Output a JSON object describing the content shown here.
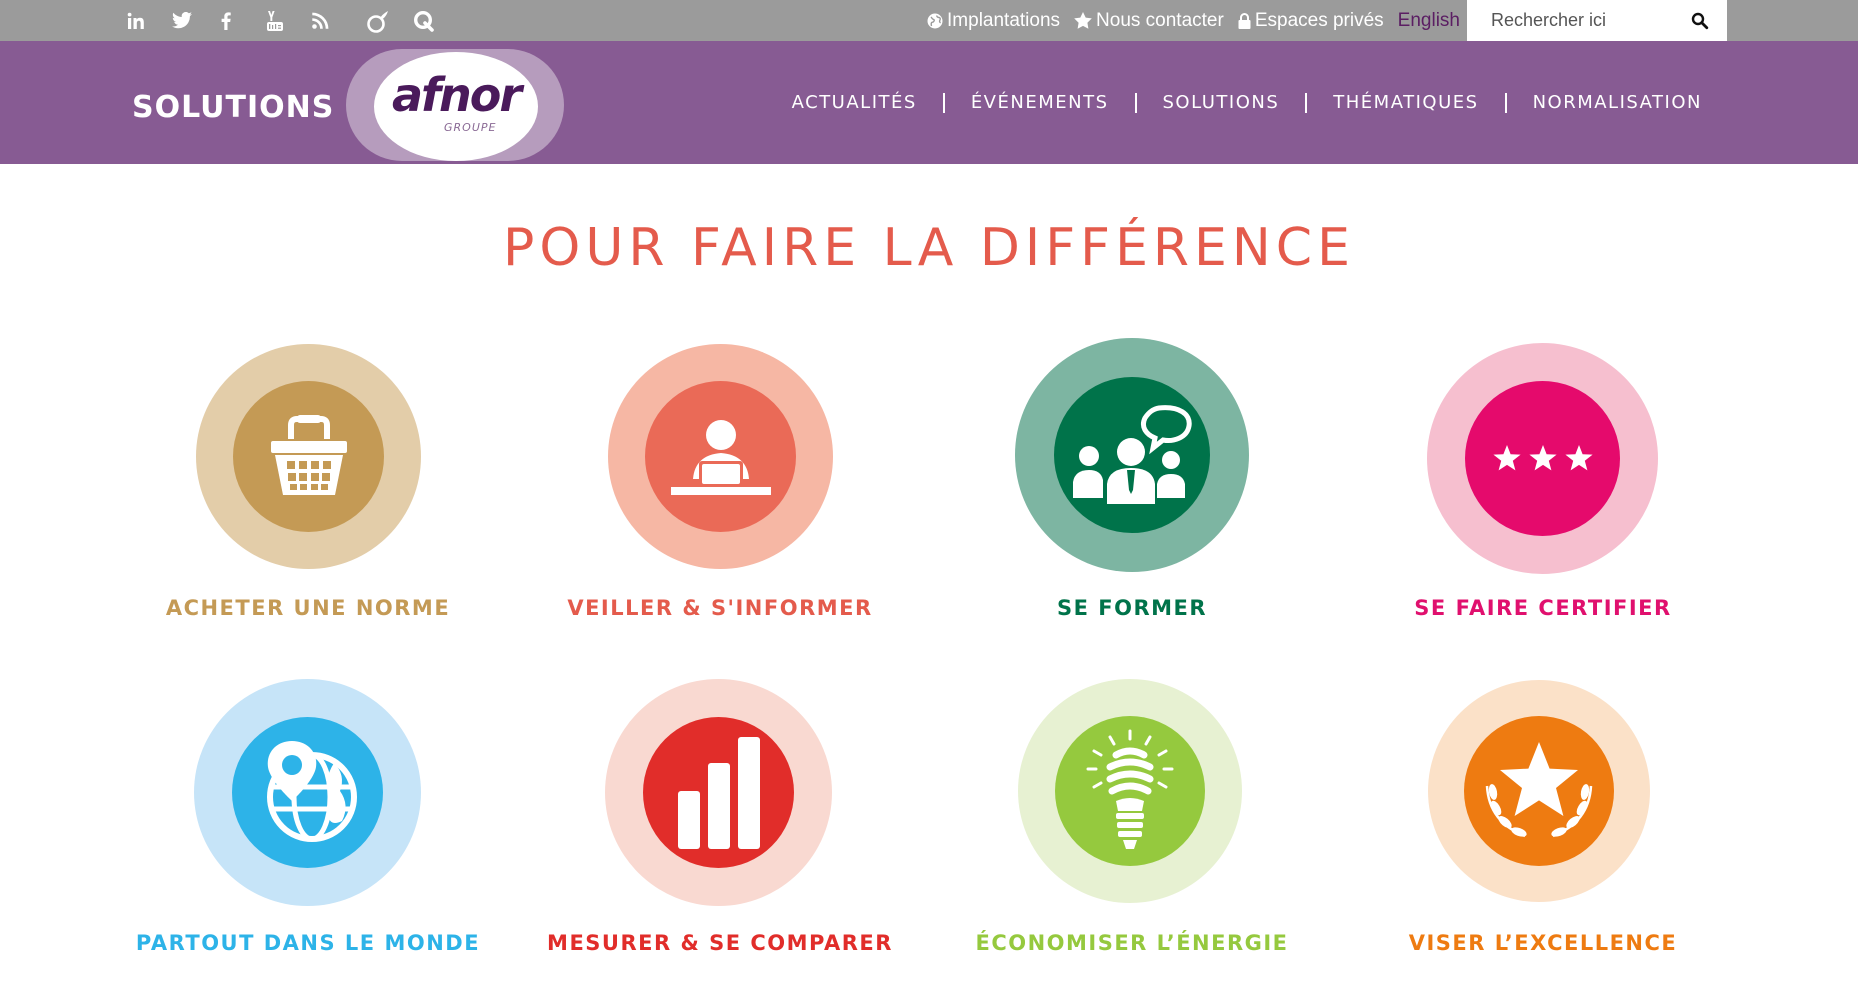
{
  "topbar": {
    "social": [
      {
        "name": "linkedin-icon"
      },
      {
        "name": "twitter-icon"
      },
      {
        "name": "facebook-icon"
      },
      {
        "name": "youtube-icon"
      },
      {
        "name": "rss-icon"
      },
      {
        "name": "viadeo-icon"
      },
      {
        "name": "q-icon"
      }
    ],
    "links": {
      "implantations": "Implantations",
      "contact": "Nous contacter",
      "private": "Espaces privés",
      "language": "English"
    },
    "search": {
      "placeholder": "Rechercher ici"
    }
  },
  "header": {
    "brand_word": "SOLUTIONS",
    "logo_text": "afnor",
    "logo_sub": "GROUPE",
    "nav": [
      "ACTUALITÉS",
      "ÉVÉNEMENTS",
      "SOLUTIONS",
      "THÉMATIQUES",
      "NORMALISATION"
    ]
  },
  "section": {
    "title": "POUR FAIRE LA DIFFÉRENCE",
    "tiles": [
      {
        "label": "ACHETER UNE NORME",
        "icon": "basket-icon",
        "outer_color": "#e3cda9",
        "inner_color": "#c49a55",
        "text_color": "#c49a55"
      },
      {
        "label": "VEILLER & S'INFORMER",
        "icon": "person-laptop-icon",
        "outer_color": "#f6b7a4",
        "inner_color": "#ea6a57",
        "text_color": "#e45b4c"
      },
      {
        "label": "SE FORMER",
        "icon": "group-chat-icon",
        "outer_color": "#7db5a2",
        "inner_color": "#00734a",
        "text_color": "#00734a"
      },
      {
        "label": "SE FAIRE CERTIFIER",
        "icon": "three-stars-icon",
        "outer_color": "#f6bfcf",
        "inner_color": "#e50a6c",
        "text_color": "#e0106e"
      },
      {
        "label": "PARTOUT DANS LE MONDE",
        "icon": "globe-pin-icon",
        "outer_color": "#c6e4f8",
        "inner_color": "#2db3e8",
        "text_color": "#2db3e8"
      },
      {
        "label": "MESURER & SE COMPARER",
        "icon": "bar-chart-icon",
        "outer_color": "#f9d9d1",
        "inner_color": "#e12d2a",
        "text_color": "#e12d2a"
      },
      {
        "label": "ÉCONOMISER L’ÉNERGIE",
        "icon": "lightbulb-icon",
        "outer_color": "#e7f1d2",
        "inner_color": "#95c93e",
        "text_color": "#95c93e"
      },
      {
        "label": "VISER L’EXCELLENCE",
        "icon": "star-laurel-icon",
        "outer_color": "#fbe1c8",
        "inner_color": "#ee7b11",
        "text_color": "#ee7b11"
      }
    ]
  }
}
